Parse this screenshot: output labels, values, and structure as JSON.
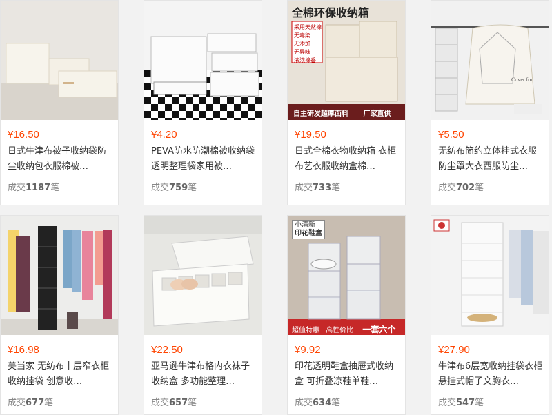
{
  "products": [
    {
      "price": "¥16.50",
      "title": "日式牛津布被子收纳袋防尘收纳包衣服棉被…",
      "sales_prefix": "成交",
      "sales_count": "1187",
      "sales_suffix": "笔"
    },
    {
      "price": "¥4.20",
      "title": "PEVA防水防潮棉被收纳袋透明整理袋家用被…",
      "sales_prefix": "成交",
      "sales_count": "759",
      "sales_suffix": "笔"
    },
    {
      "price": "¥19.50",
      "title": "日式全棉衣物收纳箱 衣柜布艺衣服收纳盒棉…",
      "sales_prefix": "成交",
      "sales_count": "733",
      "sales_suffix": "笔",
      "image_text": {
        "headline": "全棉环保收纳箱",
        "tag1": "采用天然棉",
        "tag2": "无毒染",
        "tag3": "无添加",
        "tag4": "无异味",
        "tag5": "浓浓棉香",
        "footer1": "自主研发超厚面料",
        "footer2": "厂家直供"
      }
    },
    {
      "price": "¥5.50",
      "title": "无纺布简约立体挂式衣服防尘罩大衣西服防尘…",
      "sales_prefix": "成交",
      "sales_count": "702",
      "sales_suffix": "笔",
      "image_text": {
        "cover": "Cover for"
      }
    },
    {
      "price": "¥16.98",
      "title": "美当家 无纺布十层窄衣柜收纳挂袋 创意收…",
      "sales_prefix": "成交",
      "sales_count": "677",
      "sales_suffix": "笔"
    },
    {
      "price": "¥22.50",
      "title": "亚马逊牛津布格内衣袜子收纳盒 多功能整理…",
      "sales_prefix": "成交",
      "sales_count": "657",
      "sales_suffix": "笔"
    },
    {
      "price": "¥9.92",
      "title": "印花透明鞋盒抽屉式收纳盒 可折叠凉鞋单鞋…",
      "sales_prefix": "成交",
      "sales_count": "634",
      "sales_suffix": "笔",
      "image_text": {
        "badge1": "小清新",
        "badge2": "印花鞋盒",
        "footer1": "超值特惠",
        "footer2": "高性价比",
        "footer3": "一套六个"
      }
    },
    {
      "price": "¥27.90",
      "title": "牛津布6层宽收纳挂袋衣柜悬挂式帽子文胸衣…",
      "sales_prefix": "成交",
      "sales_count": "547",
      "sales_suffix": "笔"
    }
  ],
  "colors": {
    "price": "#ff4400",
    "text": "#333333",
    "muted": "#888888",
    "background": "#f2f2f2"
  }
}
